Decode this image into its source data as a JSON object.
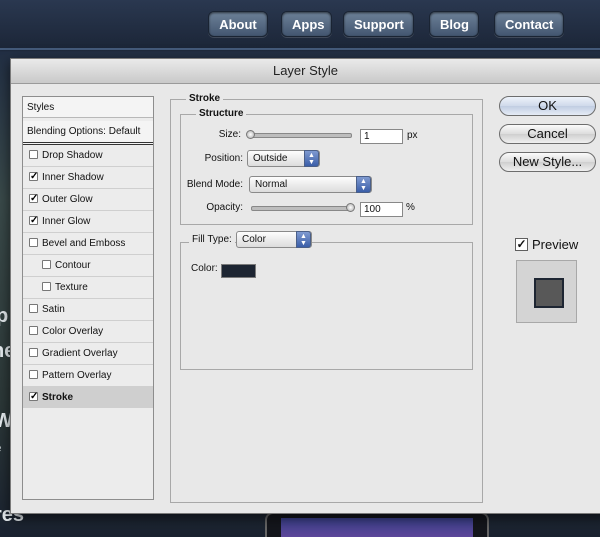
{
  "nav": {
    "items": [
      {
        "label": "About"
      },
      {
        "label": "Apps"
      },
      {
        "label": "Support"
      },
      {
        "label": "Blog"
      },
      {
        "label": "Contact"
      }
    ]
  },
  "background_text": {
    "p": "p",
    "he": "he",
    "w": "W",
    "e": "e",
    "res": "res"
  },
  "dialog": {
    "title": "Layer Style",
    "styles_header": "Styles",
    "blending_options": "Blending Options: Default",
    "effects": [
      {
        "label": "Drop Shadow",
        "checked": false,
        "check": ""
      },
      {
        "label": "Inner Shadow",
        "checked": true,
        "check": "✓"
      },
      {
        "label": "Outer Glow",
        "checked": true,
        "check": "✓"
      },
      {
        "label": "Inner Glow",
        "checked": true,
        "check": "✓"
      },
      {
        "label": "Bevel and Emboss",
        "checked": false,
        "check": ""
      },
      {
        "label": "Contour",
        "checked": false,
        "check": ""
      },
      {
        "label": "Texture",
        "checked": false,
        "check": ""
      },
      {
        "label": "Satin",
        "checked": false,
        "check": ""
      },
      {
        "label": "Color Overlay",
        "checked": false,
        "check": ""
      },
      {
        "label": "Gradient Overlay",
        "checked": false,
        "check": ""
      },
      {
        "label": "Pattern Overlay",
        "checked": false,
        "check": ""
      },
      {
        "label": "Stroke",
        "checked": true,
        "check": "✓"
      }
    ],
    "stroke": {
      "title": "Stroke",
      "structure_title": "Structure",
      "size_label": "Size:",
      "size_value": "1",
      "size_unit": "px",
      "position_label": "Position:",
      "position_value": "Outside",
      "blend_mode_label": "Blend Mode:",
      "blend_mode_value": "Normal",
      "opacity_label": "Opacity:",
      "opacity_value": "100",
      "opacity_unit": "%",
      "fill_type_label": "Fill Type:",
      "fill_type_value": "Color",
      "color_label": "Color:",
      "stroke_color": "#1d2532"
    },
    "buttons": {
      "ok": "OK",
      "cancel": "Cancel",
      "new_style": "New Style..."
    },
    "preview": {
      "label": "Preview",
      "checked": true,
      "check": "✓"
    }
  }
}
